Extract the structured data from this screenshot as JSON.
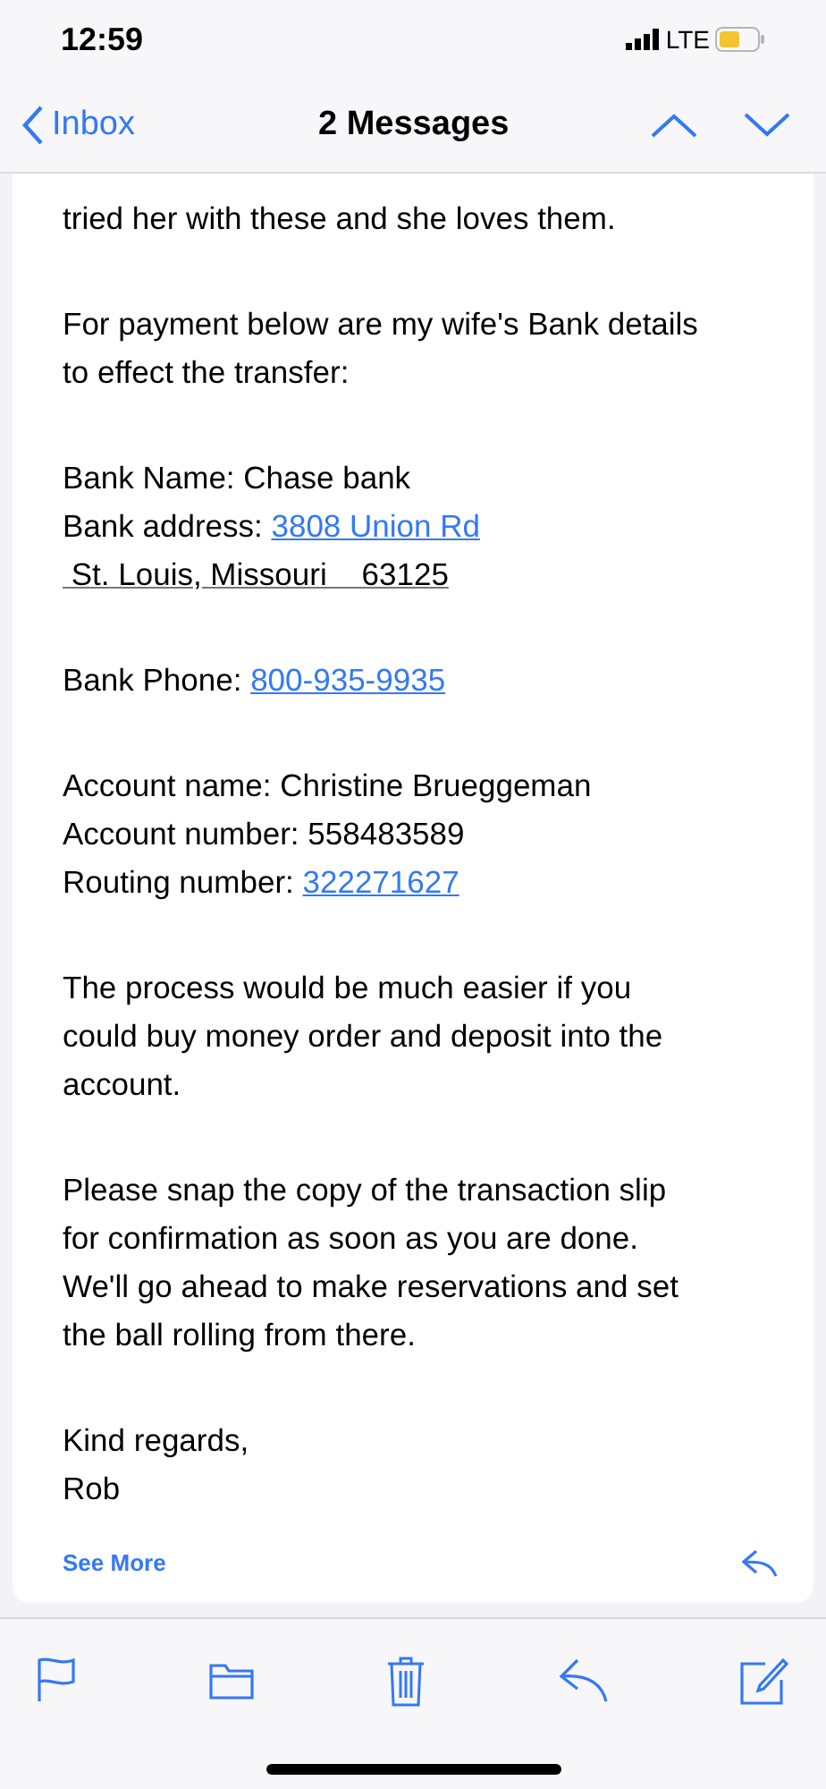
{
  "status_bar": {
    "time": "12:59",
    "network": "LTE"
  },
  "nav": {
    "back": "Inbox",
    "title": "2 Messages"
  },
  "paragraphs": [
    [
      [
        {
          "text": "tried her with these and she loves them."
        }
      ]
    ],
    [
      [
        {
          "text": "For payment below are my wife's Bank details"
        }
      ],
      [
        {
          "text": "to effect the transfer:"
        }
      ]
    ],
    [
      [
        {
          "text": "Bank Name: Chase bank"
        }
      ],
      [
        {
          "text": "Bank address: "
        },
        {
          "text": "3808 Union Rd",
          "link": true
        }
      ],
      [
        {
          "text": " St. Louis, Missouri    63125",
          "underlined": true
        }
      ]
    ],
    [
      [
        {
          "text": "Bank Phone: "
        },
        {
          "text": "800-935-9935",
          "link": true
        }
      ]
    ],
    [
      [
        {
          "text": "Account name: Christine Brueggeman"
        }
      ],
      [
        {
          "text": "Account number: 558483589"
        }
      ],
      [
        {
          "text": "Routing number: "
        },
        {
          "text": "322271627",
          "link": true
        }
      ]
    ],
    [
      [
        {
          "text": "The process would be much easier if you"
        }
      ],
      [
        {
          "text": "could buy money order and deposit into the"
        }
      ],
      [
        {
          "text": "account."
        }
      ]
    ],
    [
      [
        {
          "text": "Please snap the copy of the transaction slip"
        }
      ],
      [
        {
          "text": "for confirmation as soon as you are done."
        }
      ],
      [
        {
          "text": "We'll go ahead to make reservations and set"
        }
      ],
      [
        {
          "text": "the ball rolling from there."
        }
      ]
    ],
    [
      [
        {
          "text": "Kind regards,"
        }
      ],
      [
        {
          "text": "Rob"
        }
      ]
    ]
  ],
  "see_more": "See More"
}
